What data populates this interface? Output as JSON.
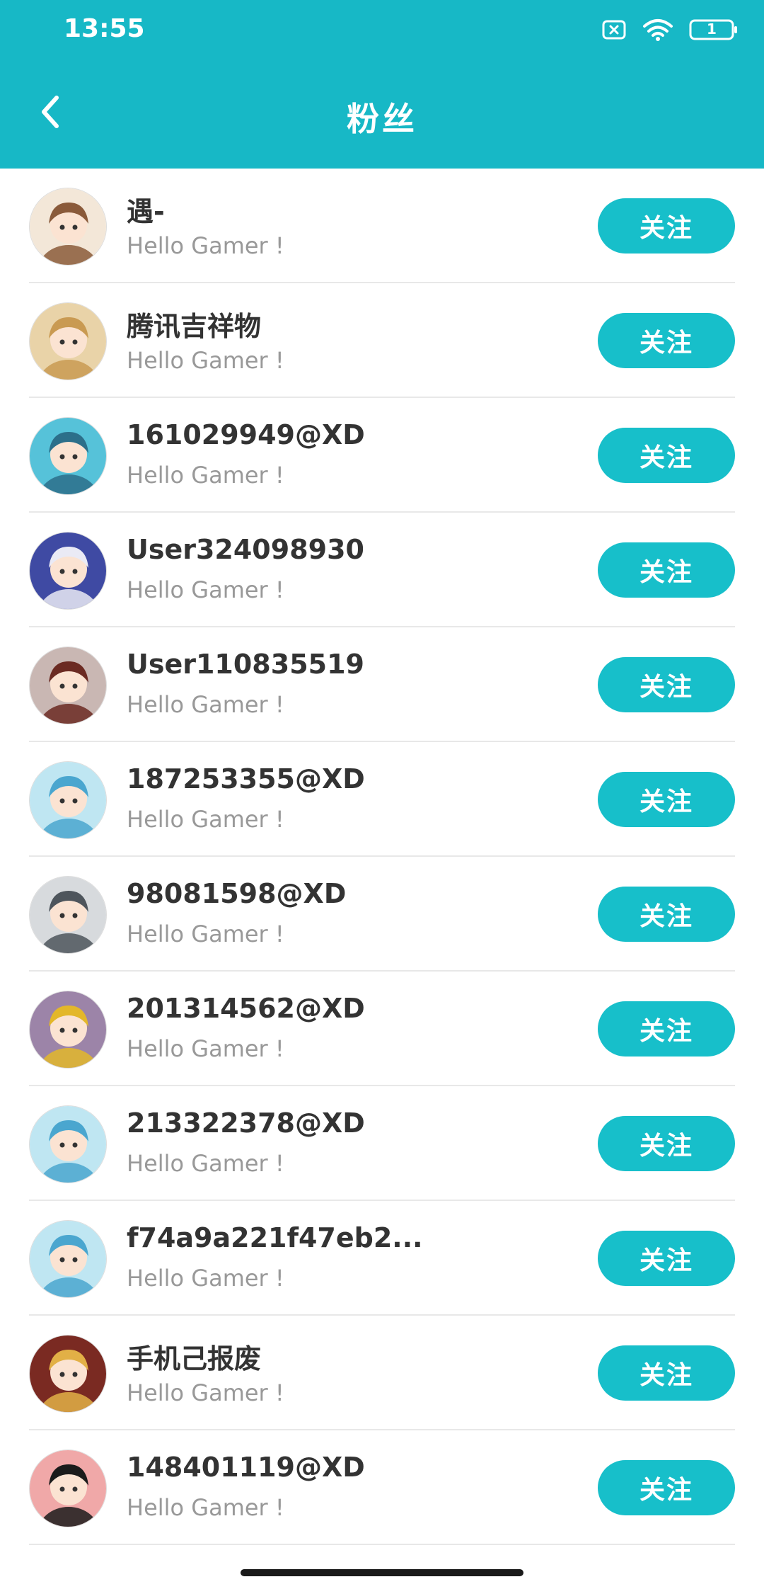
{
  "status_bar": {
    "time": "13:55",
    "battery_level": "1",
    "icons": [
      "sim-off-icon",
      "wifi-icon",
      "battery-icon"
    ]
  },
  "nav": {
    "title": "粉丝",
    "back_icon": "chevron-left-icon"
  },
  "colors": {
    "header_bg": "#17b8c6",
    "button_bg": "#17bfca",
    "name_text": "#333333",
    "bio_text": "#999999"
  },
  "fans": [
    {
      "name": "遇-",
      "bio": "Hello Gamer !",
      "button": "关注",
      "avatar": "anime-girl-brown-hair-avatar",
      "bg": "#f3e7d8",
      "fg": "#8a5a3a"
    },
    {
      "name": "腾讯吉祥物",
      "bio": "Hello Gamer !",
      "button": "关注",
      "avatar": "anime-girl-blonde-avatar",
      "bg": "#e9d3a8",
      "fg": "#c99a52"
    },
    {
      "name": "161029949@XD",
      "bio": "Hello Gamer !",
      "button": "关注",
      "avatar": "teal-character-avatar",
      "bg": "#56c2d9",
      "fg": "#2c6f8a"
    },
    {
      "name": "User324098930",
      "bio": "Hello Gamer !",
      "button": "关注",
      "avatar": "anime-girl-white-hair-avatar",
      "bg": "#3f4aa3",
      "fg": "#eaeaf5"
    },
    {
      "name": "User110835519",
      "bio": "Hello Gamer !",
      "button": "关注",
      "avatar": "fox-girl-avatar",
      "bg": "#c9b7b3",
      "fg": "#6b2a22"
    },
    {
      "name": "187253355@XD",
      "bio": "Hello Gamer !",
      "button": "关注",
      "avatar": "blue-hair-mascot-avatar",
      "bg": "#bfe6f2",
      "fg": "#4aa6cf"
    },
    {
      "name": "98081598@XD",
      "bio": "Hello Gamer !",
      "button": "关注",
      "avatar": "silver-hair-girl-avatar",
      "bg": "#d7dadd",
      "fg": "#4e555c"
    },
    {
      "name": "201314562@XD",
      "bio": "Hello Gamer !",
      "button": "关注",
      "avatar": "yellow-hat-character-avatar",
      "bg": "#9c84a8",
      "fg": "#e3b72a"
    },
    {
      "name": "213322378@XD",
      "bio": "Hello Gamer !",
      "button": "关注",
      "avatar": "blue-hair-mascot-avatar",
      "bg": "#bfe6f2",
      "fg": "#4aa6cf"
    },
    {
      "name": "f74a9a221f47eb2...",
      "bio": "Hello Gamer !",
      "button": "关注",
      "avatar": "blue-hair-mascot-avatar",
      "bg": "#bfe6f2",
      "fg": "#4aa6cf"
    },
    {
      "name": "手机己报废",
      "bio": "Hello Gamer !",
      "button": "关注",
      "avatar": "red-outfit-girl-avatar",
      "bg": "#7a2a22",
      "fg": "#e2b046"
    },
    {
      "name": "148401119@XD",
      "bio": "Hello Gamer !",
      "button": "关注",
      "avatar": "pink-doll-avatar",
      "bg": "#f0a8a8",
      "fg": "#1b1b1b"
    }
  ]
}
